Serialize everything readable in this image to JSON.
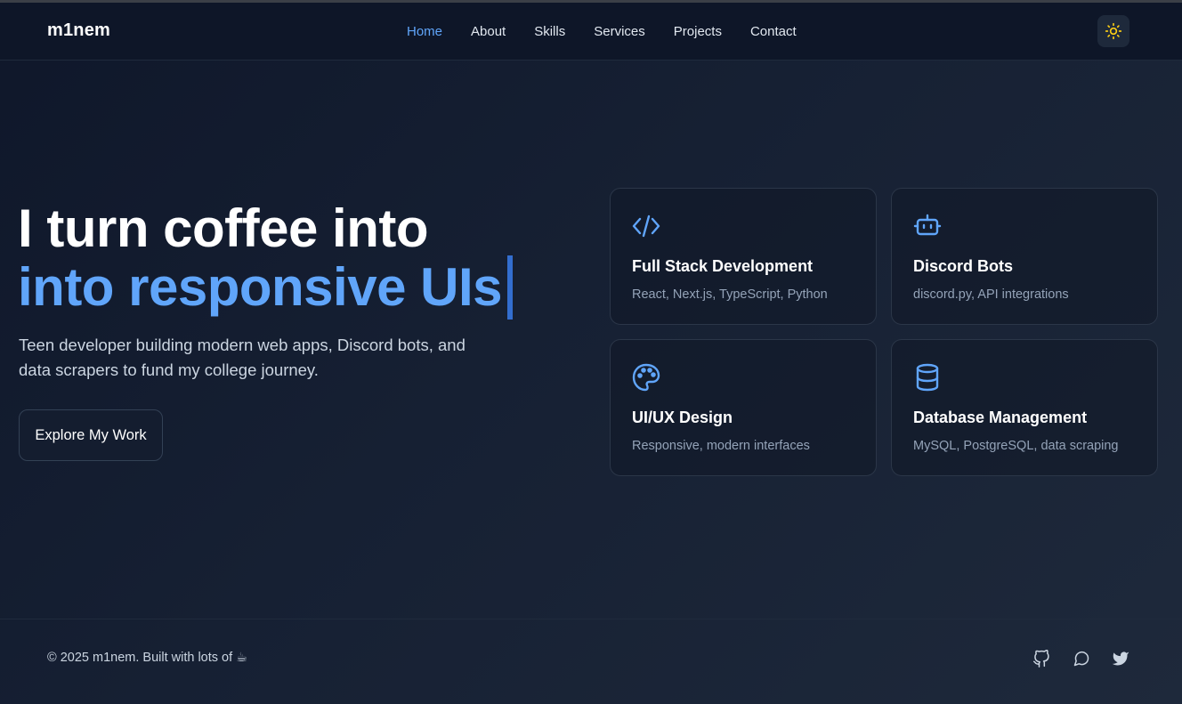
{
  "nav": {
    "logo": "m1nem",
    "links": [
      {
        "label": "Home",
        "active": true
      },
      {
        "label": "About"
      },
      {
        "label": "Skills"
      },
      {
        "label": "Services"
      },
      {
        "label": "Projects"
      },
      {
        "label": "Contact"
      }
    ],
    "theme_toggle_icon": "sun-icon"
  },
  "hero": {
    "title_line1": "I turn coffee into",
    "title_line2": "into responsive UIs",
    "subtitle": "Teen developer building modern web apps, Discord bots, and data scrapers to fund my college journey.",
    "cta_label": "Explore My Work"
  },
  "cards": [
    {
      "icon": "code-icon",
      "title": "Full Stack Development",
      "desc": "React, Next.js, TypeScript, Python"
    },
    {
      "icon": "bot-icon",
      "title": "Discord Bots",
      "desc": "discord.py, API integrations"
    },
    {
      "icon": "palette-icon",
      "title": "UI/UX Design",
      "desc": "Responsive, modern interfaces"
    },
    {
      "icon": "database-icon",
      "title": "Database Management",
      "desc": "MySQL, PostgreSQL, data scraping"
    }
  ],
  "footer": {
    "copyright": "© 2025 m1nem. Built with lots of ☕",
    "social_icons": [
      "github-icon",
      "chat-icon",
      "twitter-icon"
    ]
  },
  "colors": {
    "accent": "#60a5fa",
    "background": "#0f172a",
    "sun": "#facc15"
  }
}
